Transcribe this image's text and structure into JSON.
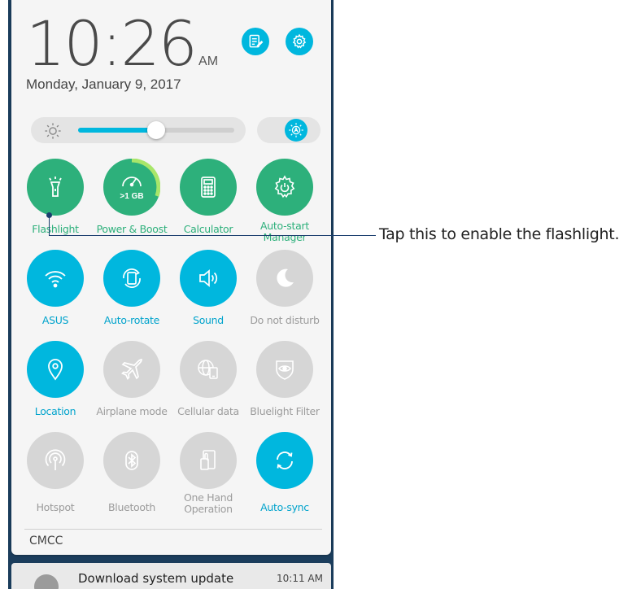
{
  "clock": {
    "time": "10:26",
    "ampm": "AM",
    "date": "Monday, January 9, 2017"
  },
  "header_buttons": [
    {
      "name": "notes",
      "icon": "notepad-icon"
    },
    {
      "name": "settings",
      "icon": "gear-icon"
    }
  ],
  "brightness": {
    "level_percent": 50,
    "auto_icon": "auto-brightness-icon"
  },
  "tiles": [
    {
      "label": "Flashlight",
      "icon": "flashlight-icon",
      "state": "on",
      "theme": "green"
    },
    {
      "label": "Power & Boost",
      "icon": "speedometer-icon",
      "state": "on",
      "theme": "green",
      "sub": ">1 GB"
    },
    {
      "label": "Calculator",
      "icon": "calculator-icon",
      "state": "on",
      "theme": "green"
    },
    {
      "label": "Auto-start Manager",
      "icon": "gear-power-icon",
      "state": "on",
      "theme": "green"
    },
    {
      "label": "ASUS",
      "icon": "wifi-icon",
      "state": "on",
      "theme": "blue"
    },
    {
      "label": "Auto-rotate",
      "icon": "rotate-icon",
      "state": "on",
      "theme": "blue"
    },
    {
      "label": "Sound",
      "icon": "speaker-icon",
      "state": "on",
      "theme": "blue"
    },
    {
      "label": "Do not disturb",
      "icon": "moon-icon",
      "state": "off",
      "theme": "grey"
    },
    {
      "label": "Location",
      "icon": "location-pin-icon",
      "state": "on",
      "theme": "blue"
    },
    {
      "label": "Airplane mode",
      "icon": "airplane-icon",
      "state": "off",
      "theme": "grey"
    },
    {
      "label": "Cellular data",
      "icon": "globe-phone-icon",
      "state": "off",
      "theme": "grey"
    },
    {
      "label": "Bluelight Filter",
      "icon": "eye-shield-icon",
      "state": "off",
      "theme": "grey"
    },
    {
      "label": "Hotspot",
      "icon": "hotspot-icon",
      "state": "off",
      "theme": "grey"
    },
    {
      "label": "Bluetooth",
      "icon": "bluetooth-icon",
      "state": "off",
      "theme": "grey"
    },
    {
      "label": "One Hand Operation",
      "icon": "one-hand-icon",
      "state": "off",
      "theme": "grey"
    },
    {
      "label": "Auto-sync",
      "icon": "sync-icon",
      "state": "on",
      "theme": "blue"
    }
  ],
  "carrier": "CMCC",
  "notification": {
    "title": "Download system update",
    "time": "10:11 AM"
  },
  "callout": {
    "text": "Tap this to enable the flashlight."
  },
  "colors": {
    "green": "#2db07b",
    "blue": "#00b7de",
    "grey": "#d6d6d6",
    "navy": "#1a3e6e"
  }
}
